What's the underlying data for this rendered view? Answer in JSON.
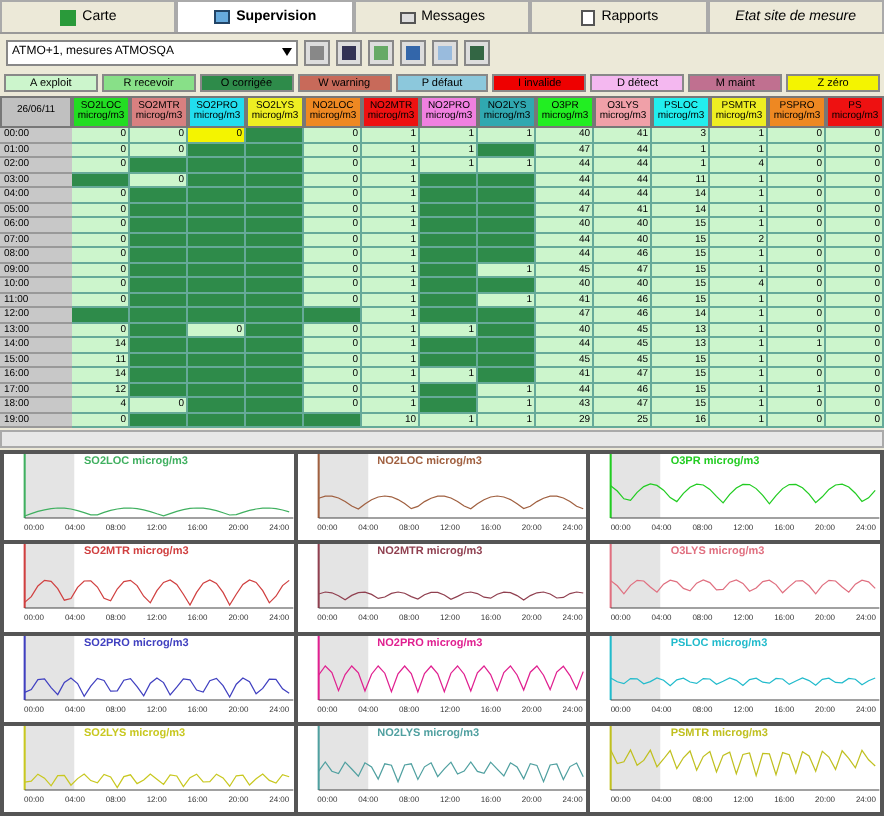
{
  "tabs": [
    {
      "label": "Carte",
      "selected": false
    },
    {
      "label": "Supervision",
      "selected": true
    },
    {
      "label": "Messages",
      "selected": false
    },
    {
      "label": "Rapports",
      "selected": false
    },
    {
      "label": "Etat site de mesure",
      "selected": false
    }
  ],
  "selector": {
    "value": "ATMO+1, mesures ATMOSQA"
  },
  "legend": [
    {
      "label": "A exploit",
      "color": "#ccf5cc"
    },
    {
      "label": "R recevoir",
      "color": "#88e088"
    },
    {
      "label": "O corrigée",
      "color": "#2e8b4a"
    },
    {
      "label": "W warning",
      "color": "#c86a5a"
    },
    {
      "label": "P défaut",
      "color": "#8cc8dc"
    },
    {
      "label": "I invalide",
      "color": "#ee0000"
    },
    {
      "label": "D détect",
      "color": "#f4b8f0"
    },
    {
      "label": "M maint",
      "color": "#c07090"
    },
    {
      "label": "Z zéro",
      "color": "#f4f400"
    }
  ],
  "table": {
    "date": "26/06/11",
    "columns": [
      {
        "name": "SO2LOC",
        "unit": "microg/m3",
        "color": "#22dd22"
      },
      {
        "name": "SO2MTR",
        "unit": "microg/m3",
        "color": "#d88080"
      },
      {
        "name": "SO2PRO",
        "unit": "microg/m3",
        "color": "#22ddee"
      },
      {
        "name": "SO2LYS",
        "unit": "microg/m3",
        "color": "#eeee22"
      },
      {
        "name": "NO2LOC",
        "unit": "microg/m3",
        "color": "#ee8822"
      },
      {
        "name": "NO2MTR",
        "unit": "microg/m3",
        "color": "#ee1111"
      },
      {
        "name": "NO2PRO",
        "unit": "microg/m3",
        "color": "#f080e0"
      },
      {
        "name": "NO2LYS",
        "unit": "microg/m3",
        "color": "#30a8b0"
      },
      {
        "name": "O3PR",
        "unit": "microg/m3",
        "color": "#22ee22"
      },
      {
        "name": "O3LYS",
        "unit": "microg/m3",
        "color": "#f0a0a8"
      },
      {
        "name": "PSLOC",
        "unit": "microg/m3",
        "color": "#22eeee"
      },
      {
        "name": "PSMTR",
        "unit": "microg/m3",
        "color": "#eeee22"
      },
      {
        "name": "PSPRO",
        "unit": "microg/m3",
        "color": "#ee8822"
      },
      {
        "name": "PS",
        "unit": "microg/m3",
        "color": "#ee1111"
      }
    ],
    "rows": [
      {
        "time": "00:00",
        "cells": [
          {
            "kind": "valid",
            "value": "0"
          },
          {
            "kind": "valid",
            "value": "0"
          },
          {
            "kind": "zero",
            "value": "0"
          },
          {
            "kind": "corrected"
          },
          {
            "kind": "valid",
            "value": "0"
          },
          {
            "kind": "valid",
            "value": "1"
          },
          {
            "kind": "valid",
            "value": "1"
          },
          {
            "kind": "valid",
            "value": "1"
          },
          {
            "kind": "valid",
            "value": "40"
          },
          {
            "kind": "valid",
            "value": "41"
          },
          {
            "kind": "valid",
            "value": "3"
          },
          {
            "kind": "valid",
            "value": "1"
          },
          {
            "kind": "valid",
            "value": "0"
          },
          {
            "kind": "valid",
            "value": "0"
          }
        ]
      },
      {
        "time": "01:00",
        "cells": [
          {
            "kind": "valid",
            "value": "0"
          },
          {
            "kind": "valid",
            "value": "0"
          },
          {
            "kind": "corrected"
          },
          {
            "kind": "corrected"
          },
          {
            "kind": "valid",
            "value": "0"
          },
          {
            "kind": "valid",
            "value": "1"
          },
          {
            "kind": "valid",
            "value": "1"
          },
          {
            "kind": "corrected"
          },
          {
            "kind": "valid",
            "value": "47"
          },
          {
            "kind": "valid",
            "value": "44"
          },
          {
            "kind": "valid",
            "value": "1"
          },
          {
            "kind": "valid",
            "value": "1"
          },
          {
            "kind": "valid",
            "value": "0"
          },
          {
            "kind": "valid",
            "value": "0"
          }
        ]
      },
      {
        "time": "02:00",
        "cells": [
          {
            "kind": "valid",
            "value": "0"
          },
          {
            "kind": "corrected"
          },
          {
            "kind": "corrected"
          },
          {
            "kind": "corrected"
          },
          {
            "kind": "valid",
            "value": "0"
          },
          {
            "kind": "valid",
            "value": "1"
          },
          {
            "kind": "valid",
            "value": "1"
          },
          {
            "kind": "valid",
            "value": "1"
          },
          {
            "kind": "valid",
            "value": "44"
          },
          {
            "kind": "valid",
            "value": "44"
          },
          {
            "kind": "valid",
            "value": "1"
          },
          {
            "kind": "valid",
            "value": "4"
          },
          {
            "kind": "valid",
            "value": "0"
          },
          {
            "kind": "valid",
            "value": "0"
          }
        ]
      },
      {
        "time": "03:00",
        "cells": [
          {
            "kind": "corrected"
          },
          {
            "kind": "valid",
            "value": "0"
          },
          {
            "kind": "corrected"
          },
          {
            "kind": "corrected"
          },
          {
            "kind": "valid",
            "value": "0"
          },
          {
            "kind": "valid",
            "value": "1"
          },
          {
            "kind": "corrected"
          },
          {
            "kind": "corrected"
          },
          {
            "kind": "valid",
            "value": "44"
          },
          {
            "kind": "valid",
            "value": "44"
          },
          {
            "kind": "valid",
            "value": "11"
          },
          {
            "kind": "valid",
            "value": "1"
          },
          {
            "kind": "valid",
            "value": "0"
          },
          {
            "kind": "valid",
            "value": "0"
          }
        ]
      },
      {
        "time": "04:00",
        "cells": [
          {
            "kind": "valid",
            "value": "0"
          },
          {
            "kind": "corrected"
          },
          {
            "kind": "corrected"
          },
          {
            "kind": "corrected"
          },
          {
            "kind": "valid",
            "value": "0"
          },
          {
            "kind": "valid",
            "value": "1"
          },
          {
            "kind": "corrected"
          },
          {
            "kind": "corrected"
          },
          {
            "kind": "valid",
            "value": "44"
          },
          {
            "kind": "valid",
            "value": "44"
          },
          {
            "kind": "valid",
            "value": "14"
          },
          {
            "kind": "valid",
            "value": "1"
          },
          {
            "kind": "valid",
            "value": "0"
          },
          {
            "kind": "valid",
            "value": "0"
          }
        ]
      },
      {
        "time": "05:00",
        "cells": [
          {
            "kind": "valid",
            "value": "0"
          },
          {
            "kind": "corrected"
          },
          {
            "kind": "corrected"
          },
          {
            "kind": "corrected"
          },
          {
            "kind": "valid",
            "value": "0"
          },
          {
            "kind": "valid",
            "value": "1"
          },
          {
            "kind": "corrected"
          },
          {
            "kind": "corrected"
          },
          {
            "kind": "valid",
            "value": "47"
          },
          {
            "kind": "valid",
            "value": "41"
          },
          {
            "kind": "valid",
            "value": "14"
          },
          {
            "kind": "valid",
            "value": "1"
          },
          {
            "kind": "valid",
            "value": "0"
          },
          {
            "kind": "valid",
            "value": "0"
          }
        ]
      },
      {
        "time": "06:00",
        "cells": [
          {
            "kind": "valid",
            "value": "0"
          },
          {
            "kind": "corrected"
          },
          {
            "kind": "corrected"
          },
          {
            "kind": "corrected"
          },
          {
            "kind": "valid",
            "value": "0"
          },
          {
            "kind": "valid",
            "value": "1"
          },
          {
            "kind": "corrected"
          },
          {
            "kind": "corrected"
          },
          {
            "kind": "valid",
            "value": "40"
          },
          {
            "kind": "valid",
            "value": "40"
          },
          {
            "kind": "valid",
            "value": "15"
          },
          {
            "kind": "valid",
            "value": "1"
          },
          {
            "kind": "valid",
            "value": "0"
          },
          {
            "kind": "valid",
            "value": "0"
          }
        ]
      },
      {
        "time": "07:00",
        "cells": [
          {
            "kind": "valid",
            "value": "0"
          },
          {
            "kind": "corrected"
          },
          {
            "kind": "corrected"
          },
          {
            "kind": "corrected"
          },
          {
            "kind": "valid",
            "value": "0"
          },
          {
            "kind": "valid",
            "value": "1"
          },
          {
            "kind": "corrected"
          },
          {
            "kind": "corrected"
          },
          {
            "kind": "valid",
            "value": "44"
          },
          {
            "kind": "valid",
            "value": "40"
          },
          {
            "kind": "valid",
            "value": "15"
          },
          {
            "kind": "valid",
            "value": "2"
          },
          {
            "kind": "valid",
            "value": "0"
          },
          {
            "kind": "valid",
            "value": "0"
          }
        ]
      },
      {
        "time": "08:00",
        "cells": [
          {
            "kind": "valid",
            "value": "0"
          },
          {
            "kind": "corrected"
          },
          {
            "kind": "corrected"
          },
          {
            "kind": "corrected"
          },
          {
            "kind": "valid",
            "value": "0"
          },
          {
            "kind": "valid",
            "value": "1"
          },
          {
            "kind": "corrected"
          },
          {
            "kind": "corrected"
          },
          {
            "kind": "valid",
            "value": "44"
          },
          {
            "kind": "valid",
            "value": "46"
          },
          {
            "kind": "valid",
            "value": "15"
          },
          {
            "kind": "valid",
            "value": "1"
          },
          {
            "kind": "valid",
            "value": "0"
          },
          {
            "kind": "valid",
            "value": "0"
          }
        ]
      },
      {
        "time": "09:00",
        "cells": [
          {
            "kind": "valid",
            "value": "0"
          },
          {
            "kind": "corrected"
          },
          {
            "kind": "corrected"
          },
          {
            "kind": "corrected"
          },
          {
            "kind": "valid",
            "value": "0"
          },
          {
            "kind": "valid",
            "value": "1"
          },
          {
            "kind": "corrected"
          },
          {
            "kind": "valid",
            "value": "1"
          },
          {
            "kind": "valid",
            "value": "45"
          },
          {
            "kind": "valid",
            "value": "47"
          },
          {
            "kind": "valid",
            "value": "15"
          },
          {
            "kind": "valid",
            "value": "1"
          },
          {
            "kind": "valid",
            "value": "0"
          },
          {
            "kind": "valid",
            "value": "0"
          }
        ]
      },
      {
        "time": "10:00",
        "cells": [
          {
            "kind": "valid",
            "value": "0"
          },
          {
            "kind": "corrected"
          },
          {
            "kind": "corrected"
          },
          {
            "kind": "corrected"
          },
          {
            "kind": "valid",
            "value": "0"
          },
          {
            "kind": "valid",
            "value": "1"
          },
          {
            "kind": "corrected"
          },
          {
            "kind": "corrected"
          },
          {
            "kind": "valid",
            "value": "40"
          },
          {
            "kind": "valid",
            "value": "40"
          },
          {
            "kind": "valid",
            "value": "15"
          },
          {
            "kind": "valid",
            "value": "4"
          },
          {
            "kind": "valid",
            "value": "0"
          },
          {
            "kind": "valid",
            "value": "0"
          }
        ]
      },
      {
        "time": "11:00",
        "cells": [
          {
            "kind": "valid",
            "value": "0"
          },
          {
            "kind": "corrected"
          },
          {
            "kind": "corrected"
          },
          {
            "kind": "corrected"
          },
          {
            "kind": "valid",
            "value": "0"
          },
          {
            "kind": "valid",
            "value": "1"
          },
          {
            "kind": "corrected"
          },
          {
            "kind": "valid",
            "value": "1"
          },
          {
            "kind": "valid",
            "value": "41"
          },
          {
            "kind": "valid",
            "value": "46"
          },
          {
            "kind": "valid",
            "value": "15"
          },
          {
            "kind": "valid",
            "value": "1"
          },
          {
            "kind": "valid",
            "value": "0"
          },
          {
            "kind": "valid",
            "value": "0"
          }
        ]
      },
      {
        "time": "12:00",
        "cells": [
          {
            "kind": "corrected"
          },
          {
            "kind": "corrected"
          },
          {
            "kind": "corrected"
          },
          {
            "kind": "corrected"
          },
          {
            "kind": "corrected"
          },
          {
            "kind": "valid",
            "value": "1"
          },
          {
            "kind": "corrected"
          },
          {
            "kind": "corrected"
          },
          {
            "kind": "valid",
            "value": "47"
          },
          {
            "kind": "valid",
            "value": "46"
          },
          {
            "kind": "valid",
            "value": "14"
          },
          {
            "kind": "valid",
            "value": "1"
          },
          {
            "kind": "valid",
            "value": "0"
          },
          {
            "kind": "valid",
            "value": "0"
          }
        ]
      },
      {
        "time": "13:00",
        "cells": [
          {
            "kind": "valid",
            "value": "0"
          },
          {
            "kind": "corrected"
          },
          {
            "kind": "valid",
            "value": "0"
          },
          {
            "kind": "corrected"
          },
          {
            "kind": "valid",
            "value": "0"
          },
          {
            "kind": "valid",
            "value": "1"
          },
          {
            "kind": "valid",
            "value": "1"
          },
          {
            "kind": "corrected"
          },
          {
            "kind": "valid",
            "value": "40"
          },
          {
            "kind": "valid",
            "value": "45"
          },
          {
            "kind": "valid",
            "value": "13"
          },
          {
            "kind": "valid",
            "value": "1"
          },
          {
            "kind": "valid",
            "value": "0"
          },
          {
            "kind": "valid",
            "value": "0"
          }
        ]
      },
      {
        "time": "14:00",
        "cells": [
          {
            "kind": "valid",
            "value": "14"
          },
          {
            "kind": "corrected"
          },
          {
            "kind": "corrected"
          },
          {
            "kind": "corrected"
          },
          {
            "kind": "valid",
            "value": "0"
          },
          {
            "kind": "valid",
            "value": "1"
          },
          {
            "kind": "corrected"
          },
          {
            "kind": "corrected"
          },
          {
            "kind": "valid",
            "value": "44"
          },
          {
            "kind": "valid",
            "value": "45"
          },
          {
            "kind": "valid",
            "value": "13"
          },
          {
            "kind": "valid",
            "value": "1"
          },
          {
            "kind": "valid",
            "value": "1"
          },
          {
            "kind": "valid",
            "value": "0"
          }
        ]
      },
      {
        "time": "15:00",
        "cells": [
          {
            "kind": "valid",
            "value": "11"
          },
          {
            "kind": "corrected"
          },
          {
            "kind": "corrected"
          },
          {
            "kind": "corrected"
          },
          {
            "kind": "valid",
            "value": "0"
          },
          {
            "kind": "valid",
            "value": "1"
          },
          {
            "kind": "corrected"
          },
          {
            "kind": "corrected"
          },
          {
            "kind": "valid",
            "value": "45"
          },
          {
            "kind": "valid",
            "value": "45"
          },
          {
            "kind": "valid",
            "value": "15"
          },
          {
            "kind": "valid",
            "value": "1"
          },
          {
            "kind": "valid",
            "value": "0"
          },
          {
            "kind": "valid",
            "value": "0"
          }
        ]
      },
      {
        "time": "16:00",
        "cells": [
          {
            "kind": "valid",
            "value": "14"
          },
          {
            "kind": "corrected"
          },
          {
            "kind": "corrected"
          },
          {
            "kind": "corrected"
          },
          {
            "kind": "valid",
            "value": "0"
          },
          {
            "kind": "valid",
            "value": "1"
          },
          {
            "kind": "valid",
            "value": "1"
          },
          {
            "kind": "corrected"
          },
          {
            "kind": "valid",
            "value": "41"
          },
          {
            "kind": "valid",
            "value": "47"
          },
          {
            "kind": "valid",
            "value": "15"
          },
          {
            "kind": "valid",
            "value": "1"
          },
          {
            "kind": "valid",
            "value": "0"
          },
          {
            "kind": "valid",
            "value": "0"
          }
        ]
      },
      {
        "time": "17:00",
        "cells": [
          {
            "kind": "valid",
            "value": "12"
          },
          {
            "kind": "corrected"
          },
          {
            "kind": "corrected"
          },
          {
            "kind": "corrected"
          },
          {
            "kind": "valid",
            "value": "0"
          },
          {
            "kind": "valid",
            "value": "1"
          },
          {
            "kind": "corrected"
          },
          {
            "kind": "valid",
            "value": "1"
          },
          {
            "kind": "valid",
            "value": "44"
          },
          {
            "kind": "valid",
            "value": "46"
          },
          {
            "kind": "valid",
            "value": "15"
          },
          {
            "kind": "valid",
            "value": "1"
          },
          {
            "kind": "valid",
            "value": "1"
          },
          {
            "kind": "valid",
            "value": "0"
          }
        ]
      },
      {
        "time": "18:00",
        "cells": [
          {
            "kind": "valid",
            "value": "4"
          },
          {
            "kind": "valid",
            "value": "0"
          },
          {
            "kind": "corrected"
          },
          {
            "kind": "corrected"
          },
          {
            "kind": "valid",
            "value": "0"
          },
          {
            "kind": "valid",
            "value": "1"
          },
          {
            "kind": "corrected"
          },
          {
            "kind": "valid",
            "value": "1"
          },
          {
            "kind": "valid",
            "value": "43"
          },
          {
            "kind": "valid",
            "value": "47"
          },
          {
            "kind": "valid",
            "value": "15"
          },
          {
            "kind": "valid",
            "value": "1"
          },
          {
            "kind": "valid",
            "value": "0"
          },
          {
            "kind": "valid",
            "value": "0"
          }
        ]
      },
      {
        "time": "19:00",
        "cells": [
          {
            "kind": "valid",
            "value": "0"
          },
          {
            "kind": "corrected"
          },
          {
            "kind": "corrected"
          },
          {
            "kind": "corrected"
          },
          {
            "kind": "corrected"
          },
          {
            "kind": "valid",
            "value": "10"
          },
          {
            "kind": "valid",
            "value": "1"
          },
          {
            "kind": "valid",
            "value": "1"
          },
          {
            "kind": "valid",
            "value": "29"
          },
          {
            "kind": "valid",
            "value": "25"
          },
          {
            "kind": "valid",
            "value": "16"
          },
          {
            "kind": "valid",
            "value": "1"
          },
          {
            "kind": "valid",
            "value": "0"
          },
          {
            "kind": "valid",
            "value": "0"
          }
        ]
      }
    ]
  },
  "charts": [
    {
      "title": "SO2LOC",
      "unit": "microg/m3",
      "color": "#40b060",
      "x_labels": [
        "00:00",
        "04:00",
        "08:00",
        "12:00",
        "16:00",
        "20:00",
        "24:00"
      ]
    },
    {
      "title": "NO2LOC",
      "unit": "microg/m3",
      "color": "#a06040",
      "x_labels": [
        "00:00",
        "04:00",
        "08:00",
        "12:00",
        "16:00",
        "20:00",
        "24:00"
      ]
    },
    {
      "title": "O3PR",
      "unit": "microg/m3",
      "color": "#22cc22",
      "x_labels": [
        "00:00",
        "04:00",
        "08:00",
        "12:00",
        "16:00",
        "20:00",
        "24:00"
      ]
    },
    {
      "title": "SO2MTR",
      "unit": "microg/m3",
      "color": "#d04040",
      "x_labels": [
        "00:00",
        "04:00",
        "08:00",
        "12:00",
        "16:00",
        "20:00",
        "24:00"
      ]
    },
    {
      "title": "NO2MTR",
      "unit": "microg/m3",
      "color": "#904050",
      "x_labels": [
        "00:00",
        "04:00",
        "08:00",
        "12:00",
        "16:00",
        "20:00",
        "24:00"
      ]
    },
    {
      "title": "O3LYS",
      "unit": "microg/m3",
      "color": "#e07080",
      "x_labels": [
        "00:00",
        "04:00",
        "08:00",
        "12:00",
        "16:00",
        "20:00",
        "24:00"
      ]
    },
    {
      "title": "SO2PRO",
      "unit": "microg/m3",
      "color": "#4040c0",
      "x_labels": [
        "00:00",
        "04:00",
        "08:00",
        "12:00",
        "16:00",
        "20:00",
        "24:00"
      ]
    },
    {
      "title": "NO2PRO",
      "unit": "microg/m3",
      "color": "#e02090",
      "x_labels": [
        "00:00",
        "04:00",
        "08:00",
        "12:00",
        "16:00",
        "20:00",
        "24:00"
      ]
    },
    {
      "title": "PSLOC",
      "unit": "microg/m3",
      "color": "#22bbcc",
      "x_labels": [
        "00:00",
        "04:00",
        "08:00",
        "12:00",
        "16:00",
        "20:00",
        "24:00"
      ]
    },
    {
      "title": "SO2LYS",
      "unit": "microg/m3",
      "color": "#c8c820",
      "x_labels": [
        "00:00",
        "04:00",
        "08:00",
        "12:00",
        "16:00",
        "20:00",
        "24:00"
      ]
    },
    {
      "title": "NO2LYS",
      "unit": "microg/m3",
      "color": "#50a0a0",
      "x_labels": [
        "00:00",
        "04:00",
        "08:00",
        "12:00",
        "16:00",
        "20:00",
        "24:00"
      ]
    },
    {
      "title": "PSMTR",
      "unit": "microg/m3",
      "color": "#c0c020",
      "x_labels": [
        "00:00",
        "04:00",
        "08:00",
        "12:00",
        "16:00",
        "20:00",
        "24:00"
      ]
    }
  ]
}
